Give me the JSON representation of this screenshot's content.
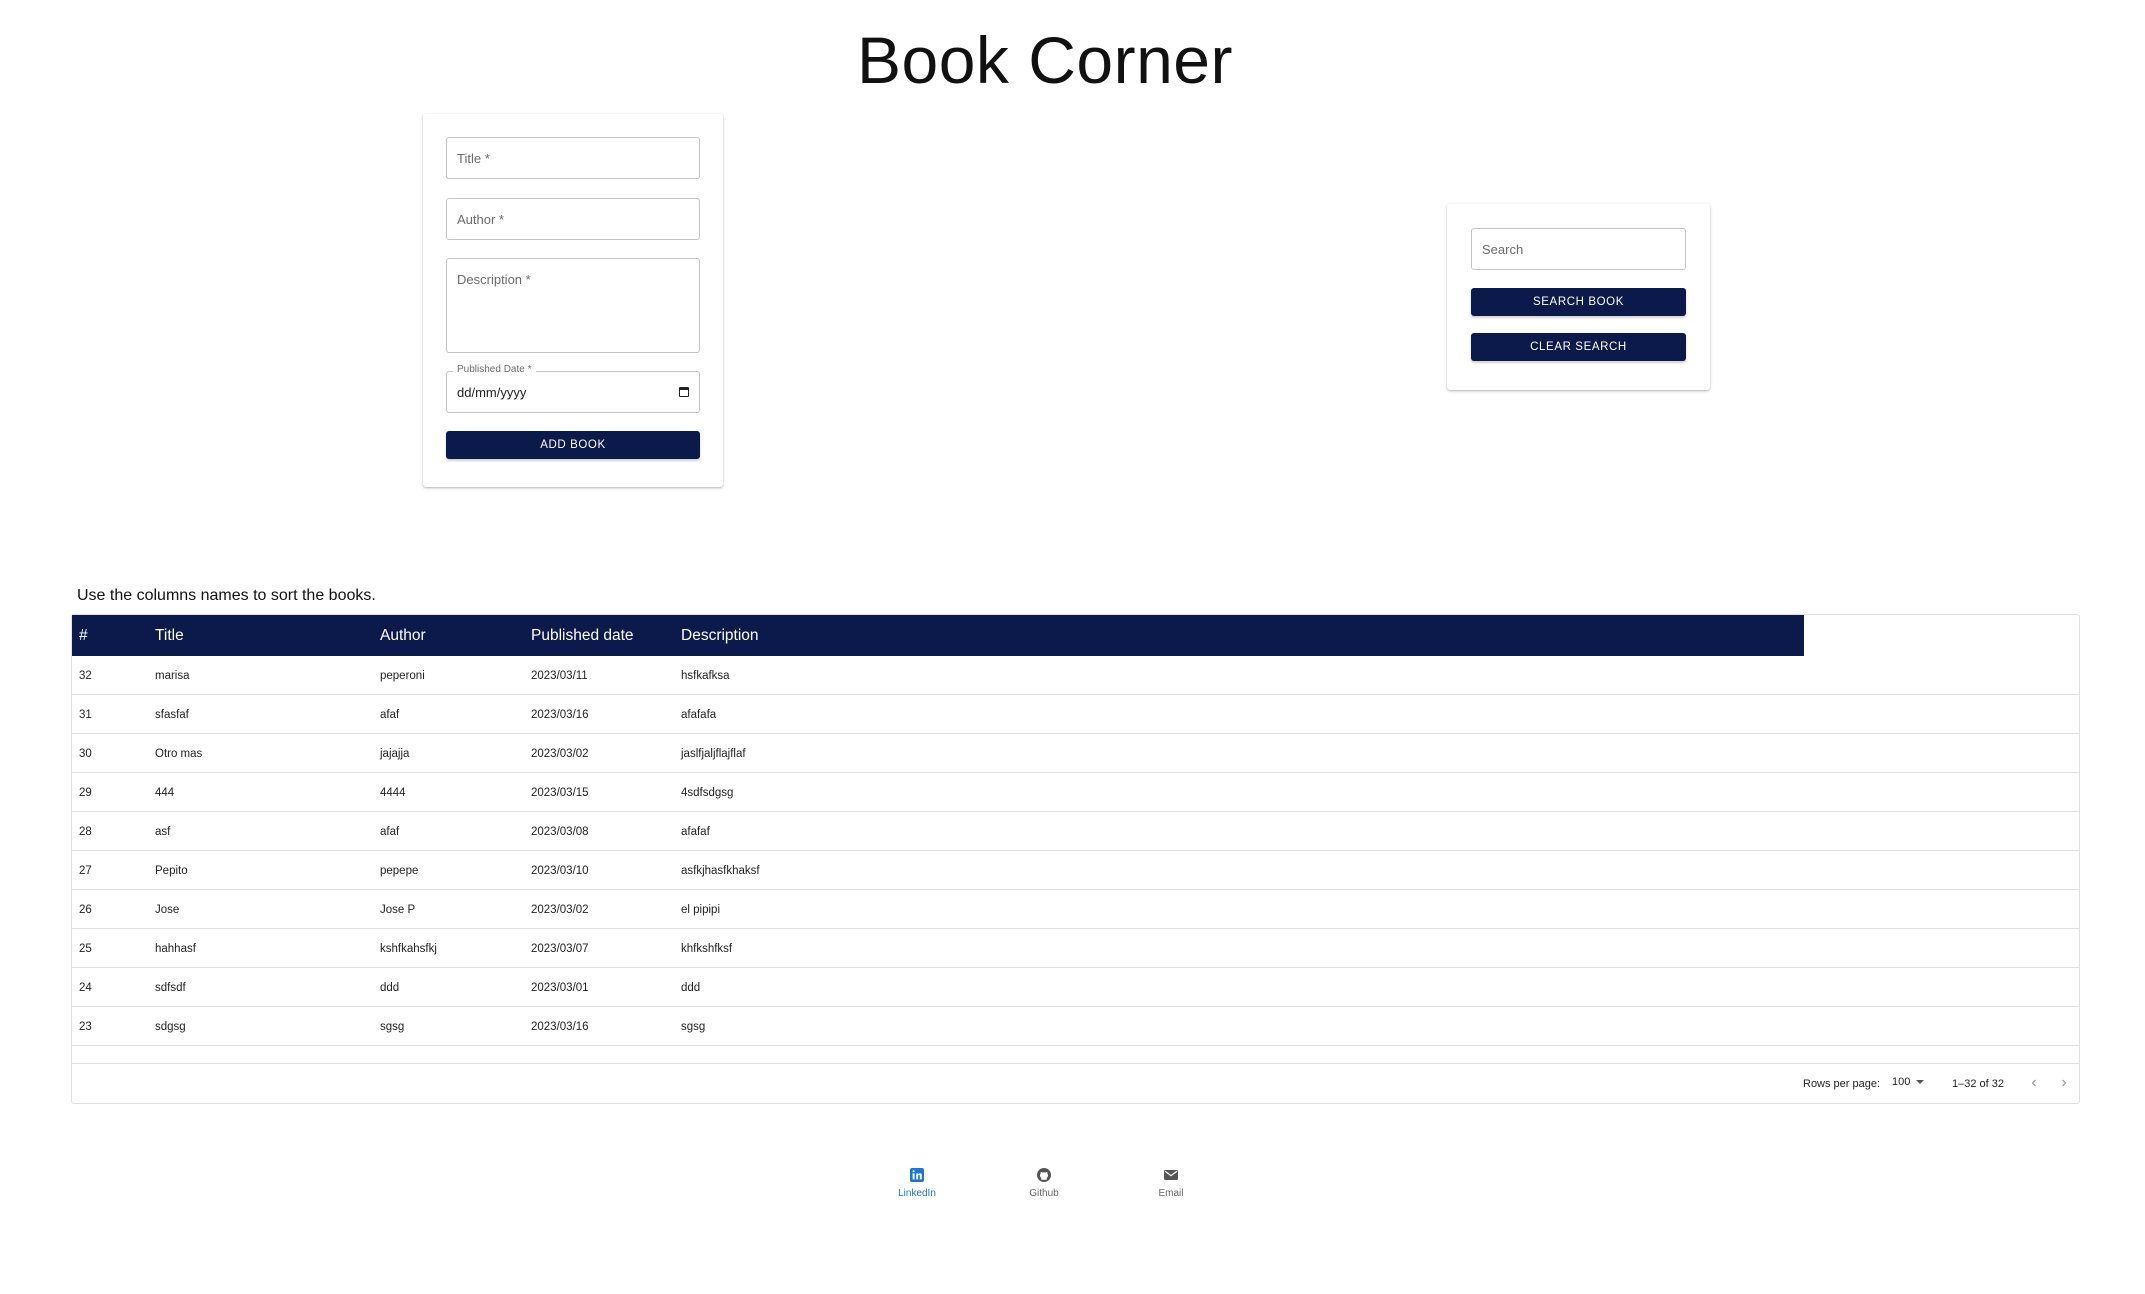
{
  "app": {
    "title": "Book Corner"
  },
  "add_form": {
    "title_placeholder": "Title *",
    "author_placeholder": "Author *",
    "description_placeholder": "Description *",
    "published_date_label": "Published Date *",
    "published_date_value": "dd/mm/yyyy",
    "add_button": "ADD BOOK"
  },
  "search_form": {
    "search_placeholder": "Search",
    "search_button": "SEARCH BOOK",
    "clear_button": "CLEAR SEARCH"
  },
  "table": {
    "hint": "Use the columns names to sort the books.",
    "columns": [
      "#",
      "Title",
      "Author",
      "Published date",
      "Description"
    ],
    "rows": [
      [
        "32",
        "marisa",
        "peperoni",
        "2023/03/11",
        "hsfkafksa"
      ],
      [
        "31",
        "sfasfaf",
        "afaf",
        "2023/03/16",
        "afafafa"
      ],
      [
        "30",
        "Otro mas",
        "jajajja",
        "2023/03/02",
        "jaslfjaljflajflaf"
      ],
      [
        "29",
        "444",
        "4444",
        "2023/03/15",
        "4sdfsdgsg"
      ],
      [
        "28",
        "asf",
        "afaf",
        "2023/03/08",
        "afafaf"
      ],
      [
        "27",
        "Pepito",
        "pepepe",
        "2023/03/10",
        "asfkjhasfkhaksf"
      ],
      [
        "26",
        "Jose",
        "Jose P",
        "2023/03/02",
        "el pipipi"
      ],
      [
        "25",
        "hahhasf",
        "kshfkahsfkj",
        "2023/03/07",
        "khfkshfksf"
      ],
      [
        "24",
        "sdfsdf",
        "ddd",
        "2023/03/01",
        "ddd"
      ],
      [
        "23",
        "sdgsg",
        "sgsg",
        "2023/03/16",
        "sgsg"
      ]
    ],
    "pagination": {
      "rows_per_page_label": "Rows per page:",
      "rows_per_page_value": "100",
      "page_info": "1–32 of 32"
    }
  },
  "bottom_nav": {
    "items": [
      {
        "label": "LinkedIn",
        "icon": "linkedin-icon",
        "active": true
      },
      {
        "label": "Github",
        "icon": "github-icon",
        "active": false
      },
      {
        "label": "Email",
        "icon": "email-icon",
        "active": false
      }
    ]
  },
  "colors": {
    "primary": "#0c1a4b",
    "active_nav": "#1976d2"
  }
}
